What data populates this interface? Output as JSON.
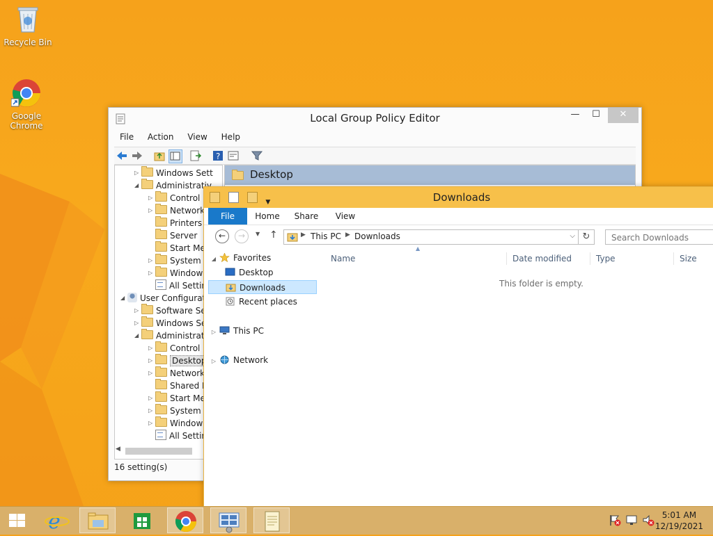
{
  "desktop": {
    "icons": [
      {
        "name": "recycle-bin",
        "label": "Recycle Bin"
      },
      {
        "name": "google-chrome",
        "label": "Google\nChrome"
      }
    ]
  },
  "gpe": {
    "title": "Local Group Policy Editor",
    "menu": [
      "File",
      "Action",
      "View",
      "Help"
    ],
    "tree": [
      {
        "label": "Windows Sett",
        "level": 1,
        "arrow": "▷",
        "icon": "folder"
      },
      {
        "label": "Administrativ",
        "level": 1,
        "arrow": "◢",
        "icon": "folder"
      },
      {
        "label": "Control I",
        "level": 2,
        "arrow": "▷",
        "icon": "folder"
      },
      {
        "label": "Network",
        "level": 2,
        "arrow": "▷",
        "icon": "folder"
      },
      {
        "label": "Printers",
        "level": 2,
        "arrow": "",
        "icon": "folder"
      },
      {
        "label": "Server",
        "level": 2,
        "arrow": "",
        "icon": "folder"
      },
      {
        "label": "Start Me",
        "level": 2,
        "arrow": "",
        "icon": "folder"
      },
      {
        "label": "System",
        "level": 2,
        "arrow": "▷",
        "icon": "folder"
      },
      {
        "label": "Window",
        "level": 2,
        "arrow": "▷",
        "icon": "folder"
      },
      {
        "label": "All Settin",
        "level": 2,
        "arrow": "",
        "icon": "settings"
      },
      {
        "label": "User Configurati",
        "level": 0,
        "arrow": "◢",
        "icon": "user"
      },
      {
        "label": "Software Set",
        "level": 1,
        "arrow": "▷",
        "icon": "folder"
      },
      {
        "label": "Windows Se",
        "level": 1,
        "arrow": "▷",
        "icon": "folder"
      },
      {
        "label": "Administrati",
        "level": 1,
        "arrow": "◢",
        "icon": "folder"
      },
      {
        "label": "Control I",
        "level": 2,
        "arrow": "▷",
        "icon": "folder"
      },
      {
        "label": "Desktop",
        "level": 2,
        "arrow": "▷",
        "icon": "folder",
        "selected": true
      },
      {
        "label": "Network",
        "level": 2,
        "arrow": "▷",
        "icon": "folder"
      },
      {
        "label": "Shared F",
        "level": 2,
        "arrow": "",
        "icon": "folder"
      },
      {
        "label": "Start Me",
        "level": 2,
        "arrow": "▷",
        "icon": "folder"
      },
      {
        "label": "System",
        "level": 2,
        "arrow": "▷",
        "icon": "folder"
      },
      {
        "label": "Window",
        "level": 2,
        "arrow": "▷",
        "icon": "folder"
      },
      {
        "label": "All Settin",
        "level": 2,
        "arrow": "",
        "icon": "settings"
      }
    ],
    "right_title": "Desktop",
    "status": "16 setting(s)"
  },
  "explorer": {
    "title": "Downloads",
    "tabs": {
      "file": "File",
      "home": "Home",
      "share": "Share",
      "view": "View"
    },
    "path": [
      "This PC",
      "Downloads"
    ],
    "search_placeholder": "Search Downloads",
    "nav": [
      {
        "label": "Favorites",
        "arrow": "◢",
        "icon": "star",
        "indent": 0
      },
      {
        "label": "Desktop",
        "arrow": "",
        "icon": "desktop",
        "indent": 1
      },
      {
        "label": "Downloads",
        "arrow": "",
        "icon": "downloads",
        "indent": 1,
        "selected": true
      },
      {
        "label": "Recent places",
        "arrow": "",
        "icon": "recent",
        "indent": 1
      },
      {
        "label": "This PC",
        "arrow": "▷",
        "icon": "pc",
        "indent": 0
      },
      {
        "label": "Network",
        "arrow": "▷",
        "icon": "network",
        "indent": 0
      }
    ],
    "columns": [
      "Name",
      "Date modified",
      "Type",
      "Size"
    ],
    "empty_text": "This folder is empty."
  },
  "taskbar": {
    "time": "5:01 AM",
    "date": "12/19/2021"
  },
  "colors": {
    "accent": "#1979ca",
    "desktop": "#f6a21b",
    "selection": "#cce8ff"
  }
}
